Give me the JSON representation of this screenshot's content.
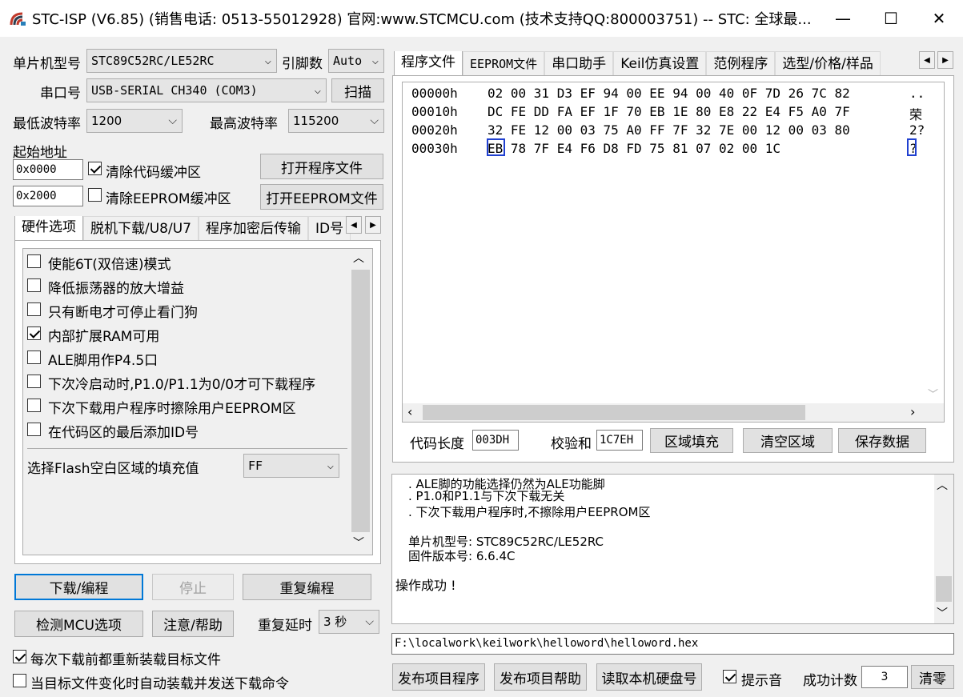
{
  "window": {
    "title": "STC-ISP (V6.85) (销售电话: 0513-55012928) 官网:www.STCMCU.com  (技术支持QQ:800003751)  -- STC: 全球最...",
    "minimize": "—",
    "maximize": "☐",
    "close": "✕"
  },
  "mcu": {
    "label": "单片机型号",
    "value": "STC89C52RC/LE52RC",
    "pins_label": "引脚数",
    "pins_value": "Auto"
  },
  "port": {
    "label": "串口号",
    "value": "USB-SERIAL CH340 (COM3)",
    "scan_button": "扫描"
  },
  "baud": {
    "min_label": "最低波特率",
    "min_value": "1200",
    "max_label": "最高波特率",
    "max_value": "115200"
  },
  "address": {
    "label": "起始地址",
    "code_addr": "0x0000",
    "eeprom_addr": "0x2000",
    "clear_code_label": "清除代码缓冲区",
    "clear_eeprom_label": "清除EEPROM缓冲区",
    "open_program": "打开程序文件",
    "open_eeprom": "打开EEPROM文件"
  },
  "left_tabs": [
    "硬件选项",
    "脱机下载/U8/U7",
    "程序加密后传输",
    "ID号"
  ],
  "hw_options": [
    {
      "label": "使能6T(双倍速)模式",
      "checked": false
    },
    {
      "label": "降低振荡器的放大增益",
      "checked": false
    },
    {
      "label": "只有断电才可停止看门狗",
      "checked": false
    },
    {
      "label": "内部扩展RAM可用",
      "checked": true
    },
    {
      "label": "ALE脚用作P4.5口",
      "checked": false
    },
    {
      "label": "下次冷启动时,P1.0/P1.1为0/0才可下载程序",
      "checked": false
    },
    {
      "label": "下次下载用户程序时擦除用户EEPROM区",
      "checked": false
    },
    {
      "label": "在代码区的最后添加ID号",
      "checked": false
    }
  ],
  "fill": {
    "label": "选择Flash空白区域的填充值",
    "value": "FF"
  },
  "actions": {
    "download": "下载/编程",
    "stop": "停止",
    "reprogram": "重复编程",
    "check_mcu": "检测MCU选项",
    "help": "注意/帮助",
    "delay_label": "重复延时",
    "delay_value": "3 秒"
  },
  "bottom_checks": {
    "reload": "每次下载前都重新装载目标文件",
    "auto_send": "当目标文件变化时自动装载并发送下载命令"
  },
  "right_tabs": [
    "程序文件",
    "EEPROM文件",
    "串口助手",
    "Keil仿真设置",
    "范例程序",
    "选型/价格/样品"
  ],
  "hex_rows": [
    {
      "addr": "00000h",
      "bytes": "02 00 31 D3 EF 94 00 EE 94 00 40 0F 7D 26 7C 82",
      "ascii": ".."
    },
    {
      "addr": "00010h",
      "bytes": "DC FE DD FA EF 1F 70 EB 1E 80 E8 22 E4 F5 A0 7F",
      "ascii": "荣"
    },
    {
      "addr": "00020h",
      "bytes": "32 FE 12 00 03 75 A0 FF 7F 32 7E 00 12 00 03 80",
      "ascii": "2?"
    },
    {
      "addr": "00030h",
      "bytes": "EB 78 7F E4 F6 D8 FD 75 81 07 02 00 1C",
      "ascii": "?"
    }
  ],
  "code_info": {
    "length_label": "代码长度",
    "length_value": "003DH",
    "checksum_label": "校验和",
    "checksum_value": "1C7EH",
    "fill_button": "区域填充",
    "clear_button": "清空区域",
    "save_button": "保存数据"
  },
  "log_lines": [
    ". ALE脚的功能选择仍然为ALE功能脚",
    ". P1.0和P1.1与下次下载无关",
    ". 下次下载用户程序时,不擦除用户EEPROM区",
    "",
    "单片机型号: STC89C52RC/LE52RC",
    "固件版本号: 6.6.4C",
    "",
    "",
    "操作成功 !"
  ],
  "file_path": "F:\\localwork\\keilwork\\helloword\\helloword.hex",
  "footer": {
    "publish_program": "发布项目程序",
    "publish_help": "发布项目帮助",
    "read_disk": "读取本机硬盘号",
    "sound_label": "提示音",
    "count_label": "成功计数",
    "count_value": "3",
    "clear_button": "清零"
  }
}
